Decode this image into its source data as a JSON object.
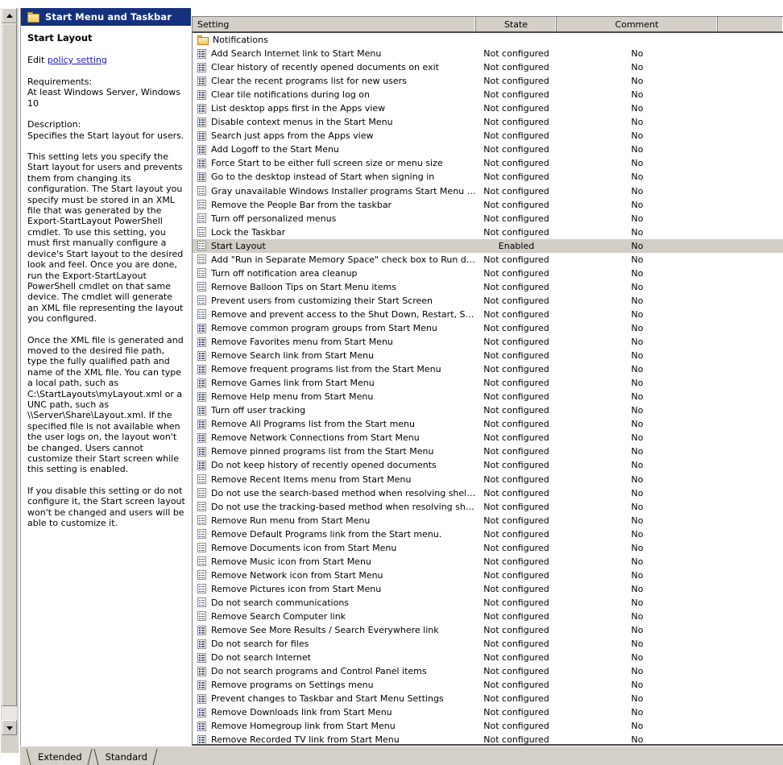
{
  "window": {
    "title": "Start Menu and Taskbar",
    "title_icon": "folder-icon"
  },
  "details_pane": {
    "heading": "Start Layout",
    "edit_prefix": "Edit",
    "edit_link": "policy setting",
    "requirements_label": "Requirements:",
    "requirements_value": "At least Windows Server, Windows 10",
    "description_label": "Description:",
    "description_summary": "Specifies the Start layout for users.",
    "paragraph_1": "This setting lets you specify the Start layout for users and prevents them from changing its configuration. The Start layout you specify must be stored in an XML file that was generated by the Export-StartLayout PowerShell cmdlet. To use this setting, you must first manually configure a device's Start layout to the desired look and feel. Once you are done, run the Export-StartLayout PowerShell cmdlet on that same device. The cmdlet will generate an XML file representing the layout you configured.",
    "paragraph_2": "Once the XML file is generated and moved to the desired file path, type the fully qualified path and name of the XML file. You can type a local path, such as C:\\StartLayouts\\myLayout.xml or a UNC path, such as \\\\Server\\Share\\Layout.xml. If the specified file is not available when the user logs on, the layout won't be changed. Users cannot customize their Start screen while this setting is enabled.",
    "paragraph_3": "If you disable this setting or do not configure it, the Start screen layout won't be changed and users will be able to customize it."
  },
  "list": {
    "columns": [
      "Setting",
      "State",
      "Comment",
      ""
    ],
    "rows": [
      {
        "icon": "folder-icon",
        "setting": "Notifications",
        "state": "",
        "comment": "",
        "selected": false
      },
      {
        "icon": "policy-icon",
        "setting": "Add Search Internet link to Start Menu",
        "state": "Not configured",
        "comment": "No",
        "selected": false
      },
      {
        "icon": "policy-icon",
        "setting": "Clear history of recently opened documents on exit",
        "state": "Not configured",
        "comment": "No",
        "selected": false
      },
      {
        "icon": "policy-icon",
        "setting": "Clear the recent programs list for new users",
        "state": "Not configured",
        "comment": "No",
        "selected": false
      },
      {
        "icon": "policy-icon",
        "setting": "Clear tile notifications during log on",
        "state": "Not configured",
        "comment": "No",
        "selected": false
      },
      {
        "icon": "policy-icon",
        "setting": "List desktop apps first in the Apps view",
        "state": "Not configured",
        "comment": "No",
        "selected": false
      },
      {
        "icon": "policy-icon",
        "setting": "Disable context menus in the Start Menu",
        "state": "Not configured",
        "comment": "No",
        "selected": false
      },
      {
        "icon": "policy-icon",
        "setting": "Search just apps from the Apps view",
        "state": "Not configured",
        "comment": "No",
        "selected": false
      },
      {
        "icon": "policy-icon",
        "setting": "Add Logoff to the Start Menu",
        "state": "Not configured",
        "comment": "No",
        "selected": false
      },
      {
        "icon": "policy-icon",
        "setting": "Force Start to be either full screen size or menu size",
        "state": "Not configured",
        "comment": "No",
        "selected": false
      },
      {
        "icon": "policy-icon",
        "setting": "Go to the desktop instead of Start when signing in",
        "state": "Not configured",
        "comment": "No",
        "selected": false
      },
      {
        "icon": "policy-icon",
        "setting": "Gray unavailable Windows Installer programs Start Menu shortcuts",
        "state": "Not configured",
        "comment": "No",
        "selected": false
      },
      {
        "icon": "policy-icon",
        "setting": "Remove the People Bar from the taskbar",
        "state": "Not configured",
        "comment": "No",
        "selected": false
      },
      {
        "icon": "policy-icon",
        "setting": "Turn off personalized menus",
        "state": "Not configured",
        "comment": "No",
        "selected": false
      },
      {
        "icon": "policy-icon",
        "setting": "Lock the Taskbar",
        "state": "Not configured",
        "comment": "No",
        "selected": false
      },
      {
        "icon": "policy-icon",
        "setting": "Start Layout",
        "state": "Enabled",
        "comment": "No",
        "selected": true
      },
      {
        "icon": "policy-icon",
        "setting": "Add \"Run in Separate Memory Space\" check box to Run dialog box",
        "state": "Not configured",
        "comment": "No",
        "selected": false
      },
      {
        "icon": "policy-icon",
        "setting": "Turn off notification area cleanup",
        "state": "Not configured",
        "comment": "No",
        "selected": false
      },
      {
        "icon": "policy-icon",
        "setting": "Remove Balloon Tips on Start Menu items",
        "state": "Not configured",
        "comment": "No",
        "selected": false
      },
      {
        "icon": "policy-icon",
        "setting": "Prevent users from customizing their Start Screen",
        "state": "Not configured",
        "comment": "No",
        "selected": false
      },
      {
        "icon": "policy-icon",
        "setting": "Remove and prevent access to the Shut Down, Restart, Sleep, a…",
        "state": "Not configured",
        "comment": "No",
        "selected": false
      },
      {
        "icon": "policy-icon",
        "setting": "Remove common program groups from Start Menu",
        "state": "Not configured",
        "comment": "No",
        "selected": false
      },
      {
        "icon": "policy-icon",
        "setting": "Remove Favorites menu from Start Menu",
        "state": "Not configured",
        "comment": "No",
        "selected": false
      },
      {
        "icon": "policy-icon",
        "setting": "Remove Search link from Start Menu",
        "state": "Not configured",
        "comment": "No",
        "selected": false
      },
      {
        "icon": "policy-icon",
        "setting": "Remove frequent programs list from the Start Menu",
        "state": "Not configured",
        "comment": "No",
        "selected": false
      },
      {
        "icon": "policy-icon",
        "setting": "Remove Games link from Start Menu",
        "state": "Not configured",
        "comment": "No",
        "selected": false
      },
      {
        "icon": "policy-icon",
        "setting": "Remove Help menu from Start Menu",
        "state": "Not configured",
        "comment": "No",
        "selected": false
      },
      {
        "icon": "policy-icon",
        "setting": "Turn off user tracking",
        "state": "Not configured",
        "comment": "No",
        "selected": false
      },
      {
        "icon": "policy-icon",
        "setting": "Remove All Programs list from the Start menu",
        "state": "Not configured",
        "comment": "No",
        "selected": false
      },
      {
        "icon": "policy-icon",
        "setting": "Remove Network Connections from Start Menu",
        "state": "Not configured",
        "comment": "No",
        "selected": false
      },
      {
        "icon": "policy-icon",
        "setting": "Remove pinned programs list from the Start Menu",
        "state": "Not configured",
        "comment": "No",
        "selected": false
      },
      {
        "icon": "policy-icon",
        "setting": "Do not keep history of recently opened documents",
        "state": "Not configured",
        "comment": "No",
        "selected": false
      },
      {
        "icon": "policy-icon",
        "setting": "Remove Recent Items menu from Start Menu",
        "state": "Not configured",
        "comment": "No",
        "selected": false
      },
      {
        "icon": "policy-icon",
        "setting": "Do not use the search-based method when resolving shell shortcuts",
        "state": "Not configured",
        "comment": "No",
        "selected": false
      },
      {
        "icon": "policy-icon",
        "setting": "Do not use the tracking-based method when resolving shell short…",
        "state": "Not configured",
        "comment": "No",
        "selected": false
      },
      {
        "icon": "policy-icon",
        "setting": "Remove Run menu from Start Menu",
        "state": "Not configured",
        "comment": "No",
        "selected": false
      },
      {
        "icon": "policy-icon",
        "setting": "Remove Default Programs link from the Start menu.",
        "state": "Not configured",
        "comment": "No",
        "selected": false
      },
      {
        "icon": "policy-icon",
        "setting": "Remove Documents icon from Start Menu",
        "state": "Not configured",
        "comment": "No",
        "selected": false
      },
      {
        "icon": "policy-icon",
        "setting": "Remove Music icon from Start Menu",
        "state": "Not configured",
        "comment": "No",
        "selected": false
      },
      {
        "icon": "policy-icon",
        "setting": "Remove Network icon from Start Menu",
        "state": "Not configured",
        "comment": "No",
        "selected": false
      },
      {
        "icon": "policy-icon",
        "setting": "Remove Pictures icon from Start Menu",
        "state": "Not configured",
        "comment": "No",
        "selected": false
      },
      {
        "icon": "policy-icon",
        "setting": "Do not search communications",
        "state": "Not configured",
        "comment": "No",
        "selected": false
      },
      {
        "icon": "policy-icon",
        "setting": "Remove Search Computer link",
        "state": "Not configured",
        "comment": "No",
        "selected": false
      },
      {
        "icon": "policy-icon",
        "setting": "Remove See More Results / Search Everywhere link",
        "state": "Not configured",
        "comment": "No",
        "selected": false
      },
      {
        "icon": "policy-icon",
        "setting": "Do not search for files",
        "state": "Not configured",
        "comment": "No",
        "selected": false
      },
      {
        "icon": "policy-icon",
        "setting": "Do not search Internet",
        "state": "Not configured",
        "comment": "No",
        "selected": false
      },
      {
        "icon": "policy-icon",
        "setting": "Do not search programs and Control Panel items",
        "state": "Not configured",
        "comment": "No",
        "selected": false
      },
      {
        "icon": "policy-icon",
        "setting": "Remove programs on Settings menu",
        "state": "Not configured",
        "comment": "No",
        "selected": false
      },
      {
        "icon": "policy-icon",
        "setting": "Prevent changes to Taskbar and Start Menu Settings",
        "state": "Not configured",
        "comment": "No",
        "selected": false
      },
      {
        "icon": "policy-icon",
        "setting": "Remove Downloads link from Start Menu",
        "state": "Not configured",
        "comment": "No",
        "selected": false
      },
      {
        "icon": "policy-icon",
        "setting": "Remove Homegroup link from Start Menu",
        "state": "Not configured",
        "comment": "No",
        "selected": false
      },
      {
        "icon": "policy-icon",
        "setting": "Remove Recorded TV link from Start Menu",
        "state": "Not configured",
        "comment": "No",
        "selected": false
      }
    ]
  },
  "tabs": [
    {
      "label": "Extended",
      "active": false
    },
    {
      "label": "Standard",
      "active": true
    }
  ],
  "colors": {
    "titlebar": "#15317e",
    "chrome": "#d4d0c8",
    "selection": "#d2cec6",
    "link": "#1818c8"
  }
}
